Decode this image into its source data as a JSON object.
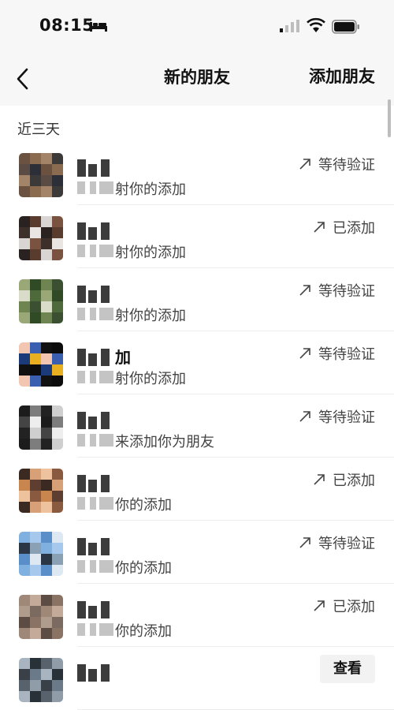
{
  "status_bar": {
    "time": "08:15"
  },
  "nav": {
    "back_icon": "chevron-left-icon",
    "title": "新的朋友",
    "add_friend": "添加朋友"
  },
  "section": {
    "label": "近三天"
  },
  "rows": [
    {
      "name_suffix": "",
      "message": "射你的添加",
      "status": "等待验证",
      "status_icon": "arrow-up-right-icon",
      "avatar_colors": [
        "#6b5240",
        "#8b6b50",
        "#a48468",
        "#3c3a38",
        "#5a4b44",
        "#2d2f38"
      ]
    },
    {
      "name_suffix": "",
      "message": "射你的添加",
      "status": "已添加",
      "status_icon": "arrow-up-right-icon",
      "avatar_colors": [
        "#e8e5e2",
        "#2a2220",
        "#5a3c2e",
        "#d9d5d2",
        "#7a5240",
        "#3d302a"
      ]
    },
    {
      "name_suffix": "",
      "message": "射你的添加",
      "status": "等待验证",
      "status_icon": "arrow-up-right-icon",
      "avatar_colors": [
        "#d8dcc8",
        "#4e6a3a",
        "#9aa878",
        "#2f4a24",
        "#6e8552",
        "#3a5030"
      ]
    },
    {
      "name_suffix": "加",
      "message": "射你的添加",
      "status": "等待验证",
      "status_icon": "arrow-up-right-icon",
      "avatar_colors": [
        "#0c0c0c",
        "#1b3a7a",
        "#e8b020",
        "#f2c6b0",
        "#3b5fb0",
        "#111111"
      ]
    },
    {
      "name_suffix": "",
      "message": "来添加你为朋友",
      "status": "等待验证",
      "status_icon": "arrow-up-right-icon",
      "avatar_colors": [
        "#222222",
        "#cfcfcf",
        "#444444",
        "#eeeeee",
        "#1c1c1c",
        "#7d7d7d"
      ]
    },
    {
      "name_suffix": "",
      "message": "你的添加",
      "status": "已添加",
      "status_icon": "arrow-up-right-icon",
      "avatar_colors": [
        "#d8a077",
        "#eec29c",
        "#8a5a40",
        "#c8864e",
        "#5e3e30",
        "#3a2a22"
      ]
    },
    {
      "name_suffix": "",
      "message": "你的添加",
      "status": "等待验证",
      "status_icon": "arrow-up-right-icon",
      "avatar_colors": [
        "#7fb0e0",
        "#a6c8ec",
        "#5a8ec8",
        "#dde8f2",
        "#2b3644",
        "#8aa0b4"
      ]
    },
    {
      "name_suffix": "",
      "message": "你的添加",
      "status": "已添加",
      "status_icon": "arrow-up-right-icon",
      "avatar_colors": [
        "#7a6a60",
        "#a08878",
        "#c4aa98",
        "#5c4c44",
        "#8a7264",
        "#b09c8c"
      ]
    },
    {
      "name_suffix": "",
      "message": "",
      "status": "",
      "action": "查看",
      "avatar_colors": [
        "#3a4048",
        "#6a7a88",
        "#a8b4c0",
        "#283038",
        "#58626c",
        "#909ca8"
      ]
    }
  ]
}
